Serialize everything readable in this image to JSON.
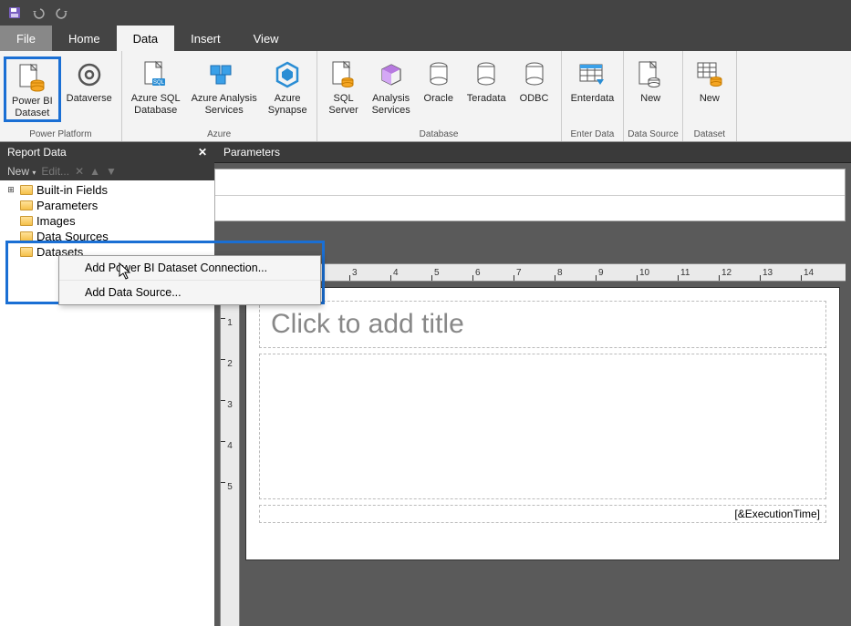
{
  "titlebar": {
    "icons": [
      "save",
      "undo",
      "redo"
    ]
  },
  "tabs": {
    "file": "File",
    "items": [
      {
        "label": "Home",
        "active": false
      },
      {
        "label": "Data",
        "active": true
      },
      {
        "label": "Insert",
        "active": false
      },
      {
        "label": "View",
        "active": false
      }
    ]
  },
  "ribbon": {
    "groups": [
      {
        "label": "Power Platform",
        "items": [
          {
            "label": "Power BI\nDataset",
            "icon": "doc-cylinder-orange",
            "highlighted": true
          },
          {
            "label": "Dataverse",
            "icon": "swirl"
          }
        ]
      },
      {
        "label": "Azure",
        "items": [
          {
            "label": "Azure SQL\nDatabase",
            "icon": "doc-blue-db"
          },
          {
            "label": "Azure Analysis\nServices",
            "icon": "cubes-blue"
          },
          {
            "label": "Azure\nSynapse",
            "icon": "hex-blue"
          }
        ]
      },
      {
        "label": "Database",
        "items": [
          {
            "label": "SQL\nServer",
            "icon": "doc-db-orange"
          },
          {
            "label": "Analysis\nServices",
            "icon": "cube-purple"
          },
          {
            "label": "Oracle",
            "icon": "cylinder"
          },
          {
            "label": "Teradata",
            "icon": "cylinder"
          },
          {
            "label": "ODBC",
            "icon": "cylinder"
          }
        ]
      },
      {
        "label": "Enter Data",
        "items": [
          {
            "label": "Enterdata",
            "icon": "table-input"
          }
        ]
      },
      {
        "label": "Data Source",
        "items": [
          {
            "label": "New",
            "icon": "doc-cylinder"
          }
        ]
      },
      {
        "label": "Dataset",
        "items": [
          {
            "label": "New",
            "icon": "table-cylinder-orange"
          }
        ]
      }
    ]
  },
  "panel": {
    "title": "Report Data",
    "new": "New",
    "edit": "Edit...",
    "tree": [
      {
        "label": "Built-in Fields",
        "expandable": true
      },
      {
        "label": "Parameters"
      },
      {
        "label": "Images"
      },
      {
        "label": "Data Sources"
      },
      {
        "label": "Datasets"
      }
    ]
  },
  "context_menu": {
    "items": [
      "Add Power BI Dataset Connection...",
      "Add Data Source..."
    ]
  },
  "params_title": "Parameters",
  "ruler_h": [
    3,
    4,
    5,
    6,
    7,
    8,
    9,
    10,
    11,
    12,
    13,
    14
  ],
  "ruler_v": [
    1,
    2,
    3,
    4,
    5
  ],
  "canvas": {
    "title_placeholder": "Click to add title",
    "footer": "[&ExecutionTime]"
  }
}
